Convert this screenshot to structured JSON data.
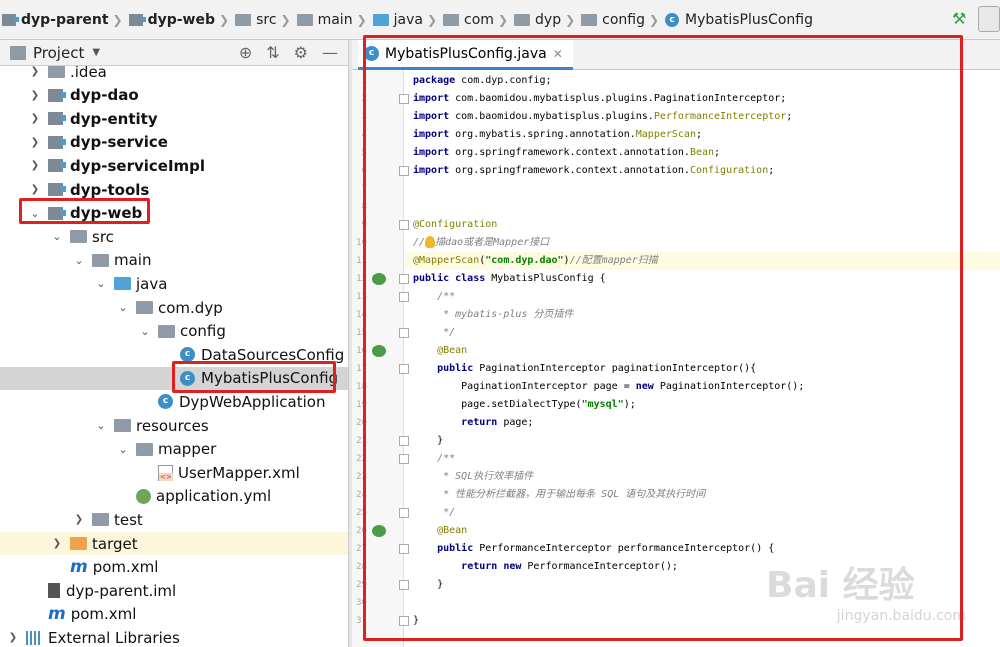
{
  "breadcrumbs": [
    {
      "label": "dyp-parent",
      "icon": "module-icon",
      "bold": true
    },
    {
      "label": "dyp-web",
      "icon": "module-icon",
      "bold": true
    },
    {
      "label": "src",
      "icon": "folder-icon",
      "bold": false
    },
    {
      "label": "main",
      "icon": "folder-icon",
      "bold": false
    },
    {
      "label": "java",
      "icon": "source-folder-icon",
      "bold": false
    },
    {
      "label": "com",
      "icon": "package-icon",
      "bold": false
    },
    {
      "label": "dyp",
      "icon": "package-icon",
      "bold": false
    },
    {
      "label": "config",
      "icon": "package-icon",
      "bold": false
    },
    {
      "label": "MybatisPlusConfig",
      "icon": "class-icon",
      "bold": false
    }
  ],
  "project_panel": {
    "title": "Project",
    "tree": [
      {
        "label": ".idea",
        "indent": 1,
        "arrow": "right",
        "icon": "folder",
        "bold": false
      },
      {
        "label": "dyp-dao",
        "indent": 1,
        "arrow": "right",
        "icon": "module",
        "bold": true
      },
      {
        "label": "dyp-entity",
        "indent": 1,
        "arrow": "right",
        "icon": "module",
        "bold": true
      },
      {
        "label": "dyp-service",
        "indent": 1,
        "arrow": "right",
        "icon": "module",
        "bold": true
      },
      {
        "label": "dyp-serviceImpl",
        "indent": 1,
        "arrow": "right",
        "icon": "module",
        "bold": true
      },
      {
        "label": "dyp-tools",
        "indent": 1,
        "arrow": "right",
        "icon": "module",
        "bold": true
      },
      {
        "label": "dyp-web",
        "indent": 1,
        "arrow": "down",
        "icon": "module",
        "bold": true
      },
      {
        "label": "src",
        "indent": 2,
        "arrow": "down",
        "icon": "folder",
        "bold": false
      },
      {
        "label": "main",
        "indent": 3,
        "arrow": "down",
        "icon": "folder",
        "bold": false
      },
      {
        "label": "java",
        "indent": 4,
        "arrow": "down",
        "icon": "java-folder",
        "bold": false
      },
      {
        "label": "com.dyp",
        "indent": 5,
        "arrow": "down",
        "icon": "folder",
        "bold": false
      },
      {
        "label": "config",
        "indent": 6,
        "arrow": "down",
        "icon": "folder",
        "bold": false
      },
      {
        "label": "DataSourcesConfig",
        "indent": 7,
        "arrow": "none",
        "icon": "class",
        "bold": false
      },
      {
        "label": "MybatisPlusConfig",
        "indent": 7,
        "arrow": "none",
        "icon": "class",
        "bold": false
      },
      {
        "label": "DypWebApplication",
        "indent": 6,
        "arrow": "none",
        "icon": "class",
        "bold": false
      },
      {
        "label": "resources",
        "indent": 4,
        "arrow": "down",
        "icon": "folder",
        "bold": false
      },
      {
        "label": "mapper",
        "indent": 5,
        "arrow": "down",
        "icon": "folder",
        "bold": false
      },
      {
        "label": "UserMapper.xml",
        "indent": 6,
        "arrow": "none",
        "icon": "xml",
        "bold": false
      },
      {
        "label": "application.yml",
        "indent": 5,
        "arrow": "none",
        "icon": "yml",
        "bold": false
      },
      {
        "label": "test",
        "indent": 3,
        "arrow": "right",
        "icon": "folder",
        "bold": false
      },
      {
        "label": "target",
        "indent": 2,
        "arrow": "right",
        "icon": "orange-folder",
        "bold": false
      },
      {
        "label": "pom.xml",
        "indent": 2,
        "arrow": "none",
        "icon": "maven",
        "bold": false
      },
      {
        "label": "dyp-parent.iml",
        "indent": 1,
        "arrow": "none",
        "icon": "iml",
        "bold": false
      },
      {
        "label": "pom.xml",
        "indent": 1,
        "arrow": "none",
        "icon": "maven",
        "bold": false
      },
      {
        "label": "External Libraries",
        "indent": 0,
        "arrow": "right",
        "icon": "libraries",
        "bold": false
      }
    ],
    "selected_item": "MybatisPlusConfig",
    "highlighted_item": "target"
  },
  "editor": {
    "tab_label": "MybatisPlusConfig.java",
    "current_line": 11,
    "lines": [
      {
        "n": "1",
        "html": "<span class='kw'>package</span> com.dyp.config;"
      },
      {
        "n": "2",
        "html": "<span class='kw'>import</span> com.baomidou.mybatisplus.plugins.PaginationInterceptor;"
      },
      {
        "n": "3",
        "html": "<span class='kw'>import</span> com.baomidou.mybatisplus.plugins.<span class='ann'>PerformanceInterceptor</span>;"
      },
      {
        "n": "4",
        "html": "<span class='kw'>import</span> org.mybatis.spring.annotation.<span class='ann'>MapperScan</span>;"
      },
      {
        "n": "5",
        "html": "<span class='kw'>import</span> org.springframework.context.annotation.<span class='ann'>Bean</span>;"
      },
      {
        "n": "6",
        "html": "<span class='kw'>import</span> org.springframework.context.annotation.<span class='ann'>Configuration</span>;"
      },
      {
        "n": "7",
        "html": ""
      },
      {
        "n": "8",
        "html": ""
      },
      {
        "n": "9",
        "html": "<span class='ann'>@Configuration</span>"
      },
      {
        "n": "10",
        "html": "<span class='cm'>//<span class='bulb'></span>描dao或者是Mapper接口</span>"
      },
      {
        "n": "11",
        "html": "<span class='ann'>@MapperScan</span>(<span class='str'>\"com.dyp.dao\"</span>)<span class='cm'>//配置mapper扫描</span>"
      },
      {
        "n": "12",
        "html": "<span class='kw'>public class</span> MybatisPlusConfig {"
      },
      {
        "n": "13",
        "html": "    <span class='cm'>/**</span>"
      },
      {
        "n": "14",
        "html": "     <span class='cm'>* mybatis-plus 分页插件</span>"
      },
      {
        "n": "15",
        "html": "     <span class='cm'>*/</span>"
      },
      {
        "n": "16",
        "html": "    <span class='ann'>@Bean</span>"
      },
      {
        "n": "17",
        "html": "    <span class='kw'>public</span> PaginationInterceptor <span class='cls'>paginationInterceptor</span>(){"
      },
      {
        "n": "18",
        "html": "        PaginationInterceptor page = <span class='kw'>new</span> PaginationInterceptor();"
      },
      {
        "n": "19",
        "html": "        page.setDialectType(<span class='str'>\"mysql\"</span>);"
      },
      {
        "n": "20",
        "html": "        <span class='kw'>return</span> page;"
      },
      {
        "n": "21",
        "html": "    }"
      },
      {
        "n": "22",
        "html": "    <span class='cm'>/**</span>"
      },
      {
        "n": "23",
        "html": "     <span class='cm'>* SQL执行效率插件</span>"
      },
      {
        "n": "24",
        "html": "     <span class='cm'>* 性能分析拦截器，用于输出每条 SQL 语句及其执行时间</span>"
      },
      {
        "n": "25",
        "html": "     <span class='cm'>*/</span>"
      },
      {
        "n": "26",
        "html": "    <span class='ann'>@Bean</span>"
      },
      {
        "n": "27",
        "html": "    <span class='kw'>public</span> PerformanceInterceptor <span class='cls'>performanceInterceptor</span>() {"
      },
      {
        "n": "28",
        "html": "        <span class='kw'>return new</span> PerformanceInterceptor();"
      },
      {
        "n": "29",
        "html": "    }"
      },
      {
        "n": "30",
        "html": ""
      },
      {
        "n": "31",
        "html": "}"
      }
    ]
  },
  "watermark": {
    "text": "Bai 经验",
    "sub": "jingyan.baidu.com"
  },
  "colors": {
    "annotation_box": "#e02020",
    "keyword": "#000080",
    "annotation": "#808000",
    "string": "#008000",
    "comment": "#808080",
    "selection": "#d4d4d4"
  }
}
